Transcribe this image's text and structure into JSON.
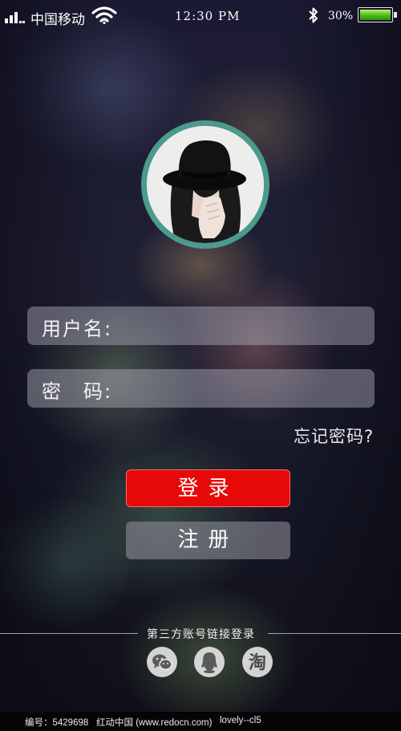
{
  "status_bar": {
    "carrier": "中国移动",
    "time": "12:30 PM",
    "battery_percent": "30%"
  },
  "login_form": {
    "username_label": "用户名:",
    "password_label": "密　码:",
    "username_value": "",
    "password_value": "",
    "forgot_password": "忘记密码?",
    "login_button": "登录",
    "register_button": "注册"
  },
  "third_party": {
    "title": "第三方账号链接登录",
    "providers": [
      "wechat-icon",
      "qq-icon",
      "taobao-icon"
    ],
    "taobao_glyph": "淘"
  },
  "watermark": {
    "id": "编号：5429698",
    "site": "红动中国 (www.redocn.com)",
    "author": "lovely--cl5"
  },
  "colors": {
    "login_button": "#e60909",
    "avatar_ring": "#4a9a8d",
    "battery_fill": "#4fc21a"
  }
}
